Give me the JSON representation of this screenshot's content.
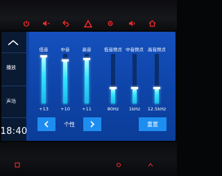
{
  "hardware": {
    "top_icons": [
      "power-icon",
      "volume-down-icon",
      "back-icon",
      "hazard-icon",
      "settings-icon",
      "volume-up-icon",
      "home-icon"
    ],
    "accent_color": "#ff2a2a"
  },
  "sidebar": {
    "home_icon": "home-icon",
    "items": [
      {
        "label": "播放"
      },
      {
        "label": "声场"
      }
    ],
    "clock": "18:40"
  },
  "eq": {
    "bands": [
      {
        "label": "低音",
        "value_text": "+13",
        "level": 0.95
      },
      {
        "label": "中音",
        "value_text": "+10",
        "level": 0.86
      },
      {
        "label": "高音",
        "value_text": "+11",
        "level": 0.89
      },
      {
        "label": "低音频点",
        "value_text": "80Hz",
        "level": 0.3
      },
      {
        "label": "中音频点",
        "value_text": "1kHz",
        "level": 0.3
      },
      {
        "label": "高音频点",
        "value_text": "12.5kHz",
        "level": 0.3
      }
    ],
    "preset_label": "个性",
    "reset_label": "重置",
    "accent": "#35e5ff"
  }
}
